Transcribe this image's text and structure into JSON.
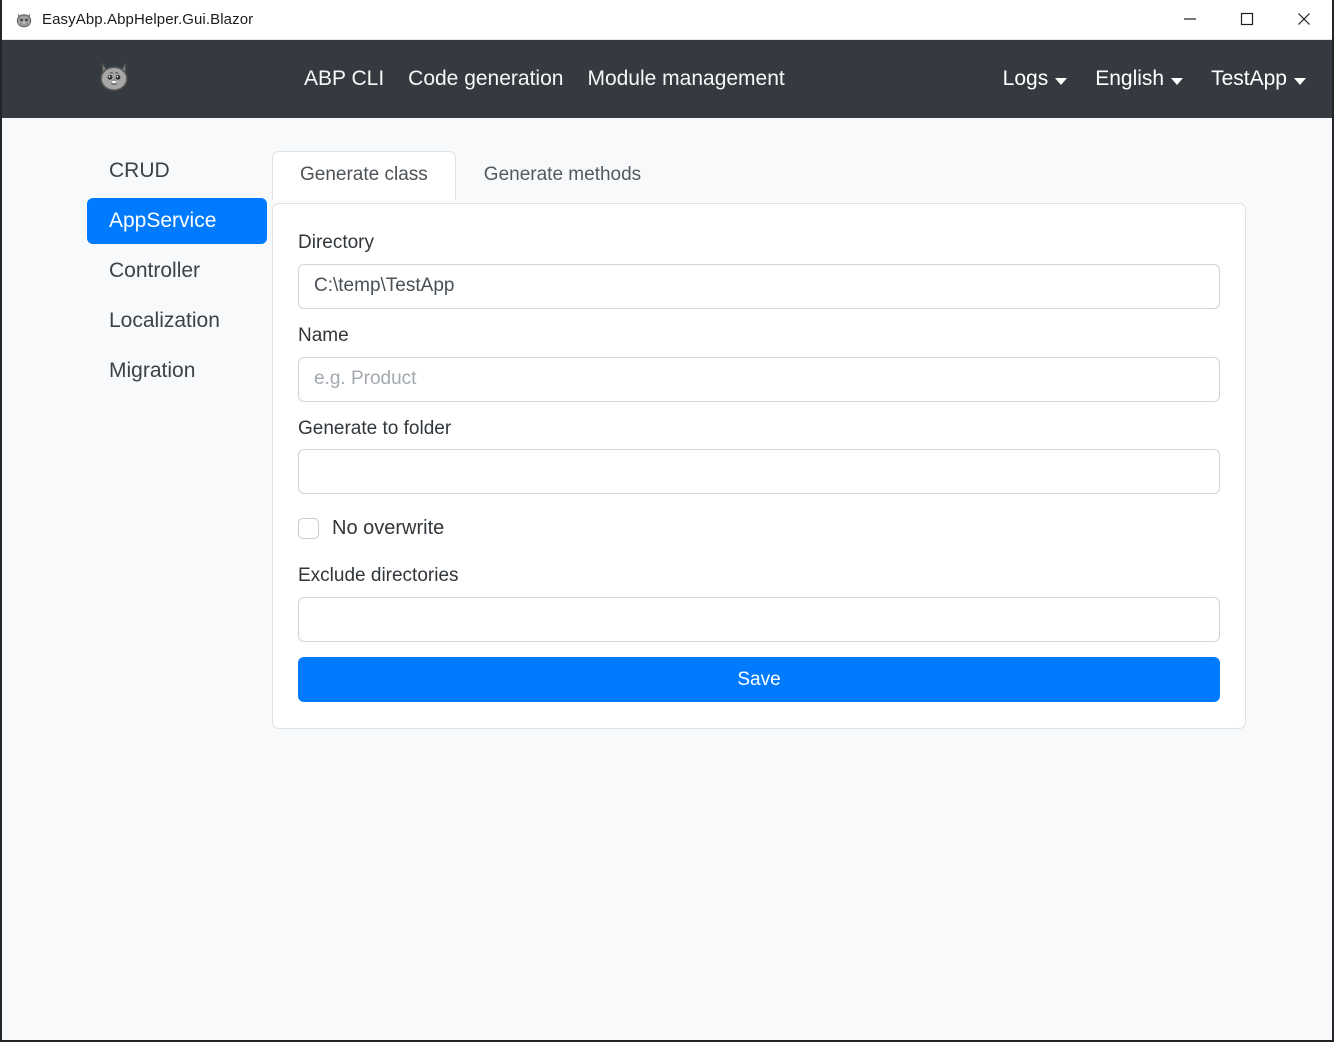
{
  "titlebar": {
    "icon": "cat-face-icon",
    "title": "EasyAbp.AbpHelper.Gui.Blazor",
    "minimize_label": "─",
    "maximize_label": "□",
    "close_label": "✕"
  },
  "navbar": {
    "brand_icon": "cat-face-logo",
    "brand_glyph": "🐱",
    "links": [
      {
        "label": "ABP CLI"
      },
      {
        "label": "Code generation"
      },
      {
        "label": "Module management"
      }
    ],
    "dropdowns": [
      {
        "label": "Logs"
      },
      {
        "label": "English"
      },
      {
        "label": "TestApp"
      }
    ]
  },
  "sidebar": {
    "items": [
      {
        "label": "CRUD",
        "active": false
      },
      {
        "label": "AppService",
        "active": true
      },
      {
        "label": "Controller",
        "active": false
      },
      {
        "label": "Localization",
        "active": false
      },
      {
        "label": "Migration",
        "active": false
      }
    ]
  },
  "main": {
    "tabs": [
      {
        "label": "Generate class",
        "active": true
      },
      {
        "label": "Generate methods",
        "active": false
      }
    ],
    "form": {
      "directory": {
        "label": "Directory",
        "value": "C:\\temp\\TestApp",
        "placeholder": ""
      },
      "name": {
        "label": "Name",
        "value": "",
        "placeholder": "e.g. Product"
      },
      "generate_to_folder": {
        "label": "Generate to folder",
        "value": "",
        "placeholder": ""
      },
      "no_overwrite": {
        "label": "No overwrite",
        "checked": false
      },
      "exclude_directories": {
        "label": "Exclude directories",
        "value": "",
        "placeholder": ""
      },
      "save_label": "Save"
    }
  },
  "colors": {
    "accent": "#007bff",
    "navbar_bg": "#343a40",
    "page_bg": "#f8f9fa",
    "card_bg": "#ffffff",
    "border": "#dfe2e5"
  }
}
